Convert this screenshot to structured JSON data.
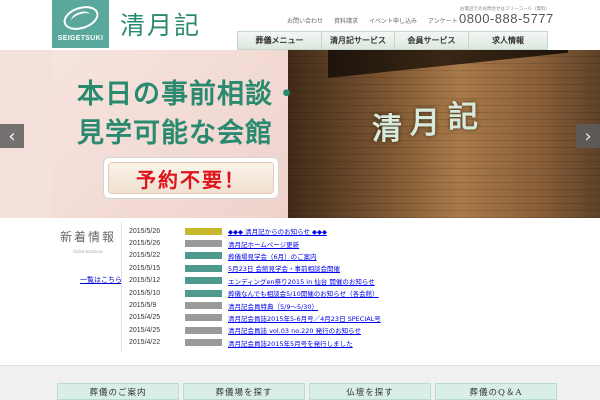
{
  "header": {
    "logo_text": "SEIGETSUKI",
    "brand_name": "清月記",
    "util_links": [
      "お問い合わせ",
      "資料請求",
      "イベント申し込み",
      "アンケート"
    ],
    "tel_note": "お電話でのお問合せはフリーコール（無料）",
    "tel_number": "0800-888-5777",
    "nav": [
      "葬儀メニュー",
      "清月記サービス",
      "会員サービス",
      "求人情報"
    ]
  },
  "hero": {
    "line1": "本日の事前相談・",
    "line2": "見学可能な会館",
    "cta": "予約不要！",
    "sign": [
      "清",
      "月",
      "記"
    ]
  },
  "news": {
    "title": "新着情報",
    "subtitle": "Information",
    "more": "一覧はこちら",
    "items": [
      {
        "date": "2015/5/26",
        "badge_color": "#c8b82f",
        "text": "◆◆◆ 清月記からのお知らせ ◆◆◆"
      },
      {
        "date": "2015/5/26",
        "badge_color": "#9a9a9a",
        "text": "清月記ホームページ更新"
      },
      {
        "date": "2015/5/22",
        "badge_color": "#4f9a8f",
        "text": "葬儀場見学会（6月）のご案内"
      },
      {
        "date": "2015/5/15",
        "badge_color": "#4f9a8f",
        "text": "5月23日 会館見学会・事前相談会開催"
      },
      {
        "date": "2015/5/12",
        "badge_color": "#4f9a8f",
        "text": "エンディングen祭り2015 in 仙台 開催のお知らせ"
      },
      {
        "date": "2015/5/10",
        "badge_color": "#4f9a8f",
        "text": "葬儀なんでも相談会5/10開催のお知らせ（各会館）"
      },
      {
        "date": "2015/5/9",
        "badge_color": "#9a9a9a",
        "text": "清月記会員特典（5/9〜5/30）"
      },
      {
        "date": "2015/4/25",
        "badge_color": "#9a9a9a",
        "text": "清月記会員誌2015年5-6月号／4月23日 SPECIAL号"
      },
      {
        "date": "2015/4/25",
        "badge_color": "#9a9a9a",
        "text": "清月記会員誌 vol.03 no.220 発行のお知らせ"
      },
      {
        "date": "2015/4/22",
        "badge_color": "#9a9a9a",
        "text": "清月記会員誌2015年5月号を発行しました"
      }
    ]
  },
  "bottom_nav": [
    "葬儀のご案内",
    "葬儀場を探す",
    "仏壇を探す",
    "葬儀のQ＆A"
  ],
  "colors": {
    "brand": "#2a8a6f",
    "logo_bg": "#5aa79c",
    "cta_text": "#e0121b"
  }
}
